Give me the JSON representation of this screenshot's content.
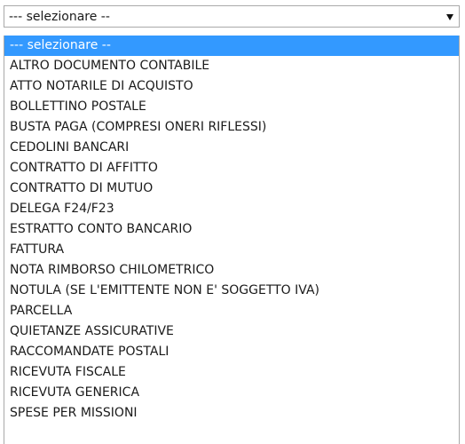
{
  "select": {
    "value": "--- selezionare --"
  },
  "options": [
    "--- selezionare --",
    "ALTRO DOCUMENTO CONTABILE",
    "ATTO NOTARILE DI ACQUISTO",
    "BOLLETTINO POSTALE",
    "BUSTA PAGA (COMPRESI ONERI RIFLESSI)",
    "CEDOLINI BANCARI",
    "CONTRATTO DI AFFITTO",
    "CONTRATTO DI MUTUO",
    "DELEGA F24/F23",
    "ESTRATTO CONTO BANCARIO",
    "FATTURA",
    "NOTA RIMBORSO CHILOMETRICO",
    "NOTULA (SE L'EMITTENTE NON E' SOGGETTO IVA)",
    "PARCELLA",
    "QUIETANZE ASSICURATIVE",
    "RACCOMANDATE POSTALI",
    "RICEVUTA FISCALE",
    "RICEVUTA GENERICA",
    "SPESE PER MISSIONI"
  ],
  "highlighted_option": "--- selezionare --",
  "colors": {
    "highlight": "#3399ff",
    "border": "#a9a9a9"
  },
  "icons": {
    "dropdown": "chevron-down-icon"
  }
}
